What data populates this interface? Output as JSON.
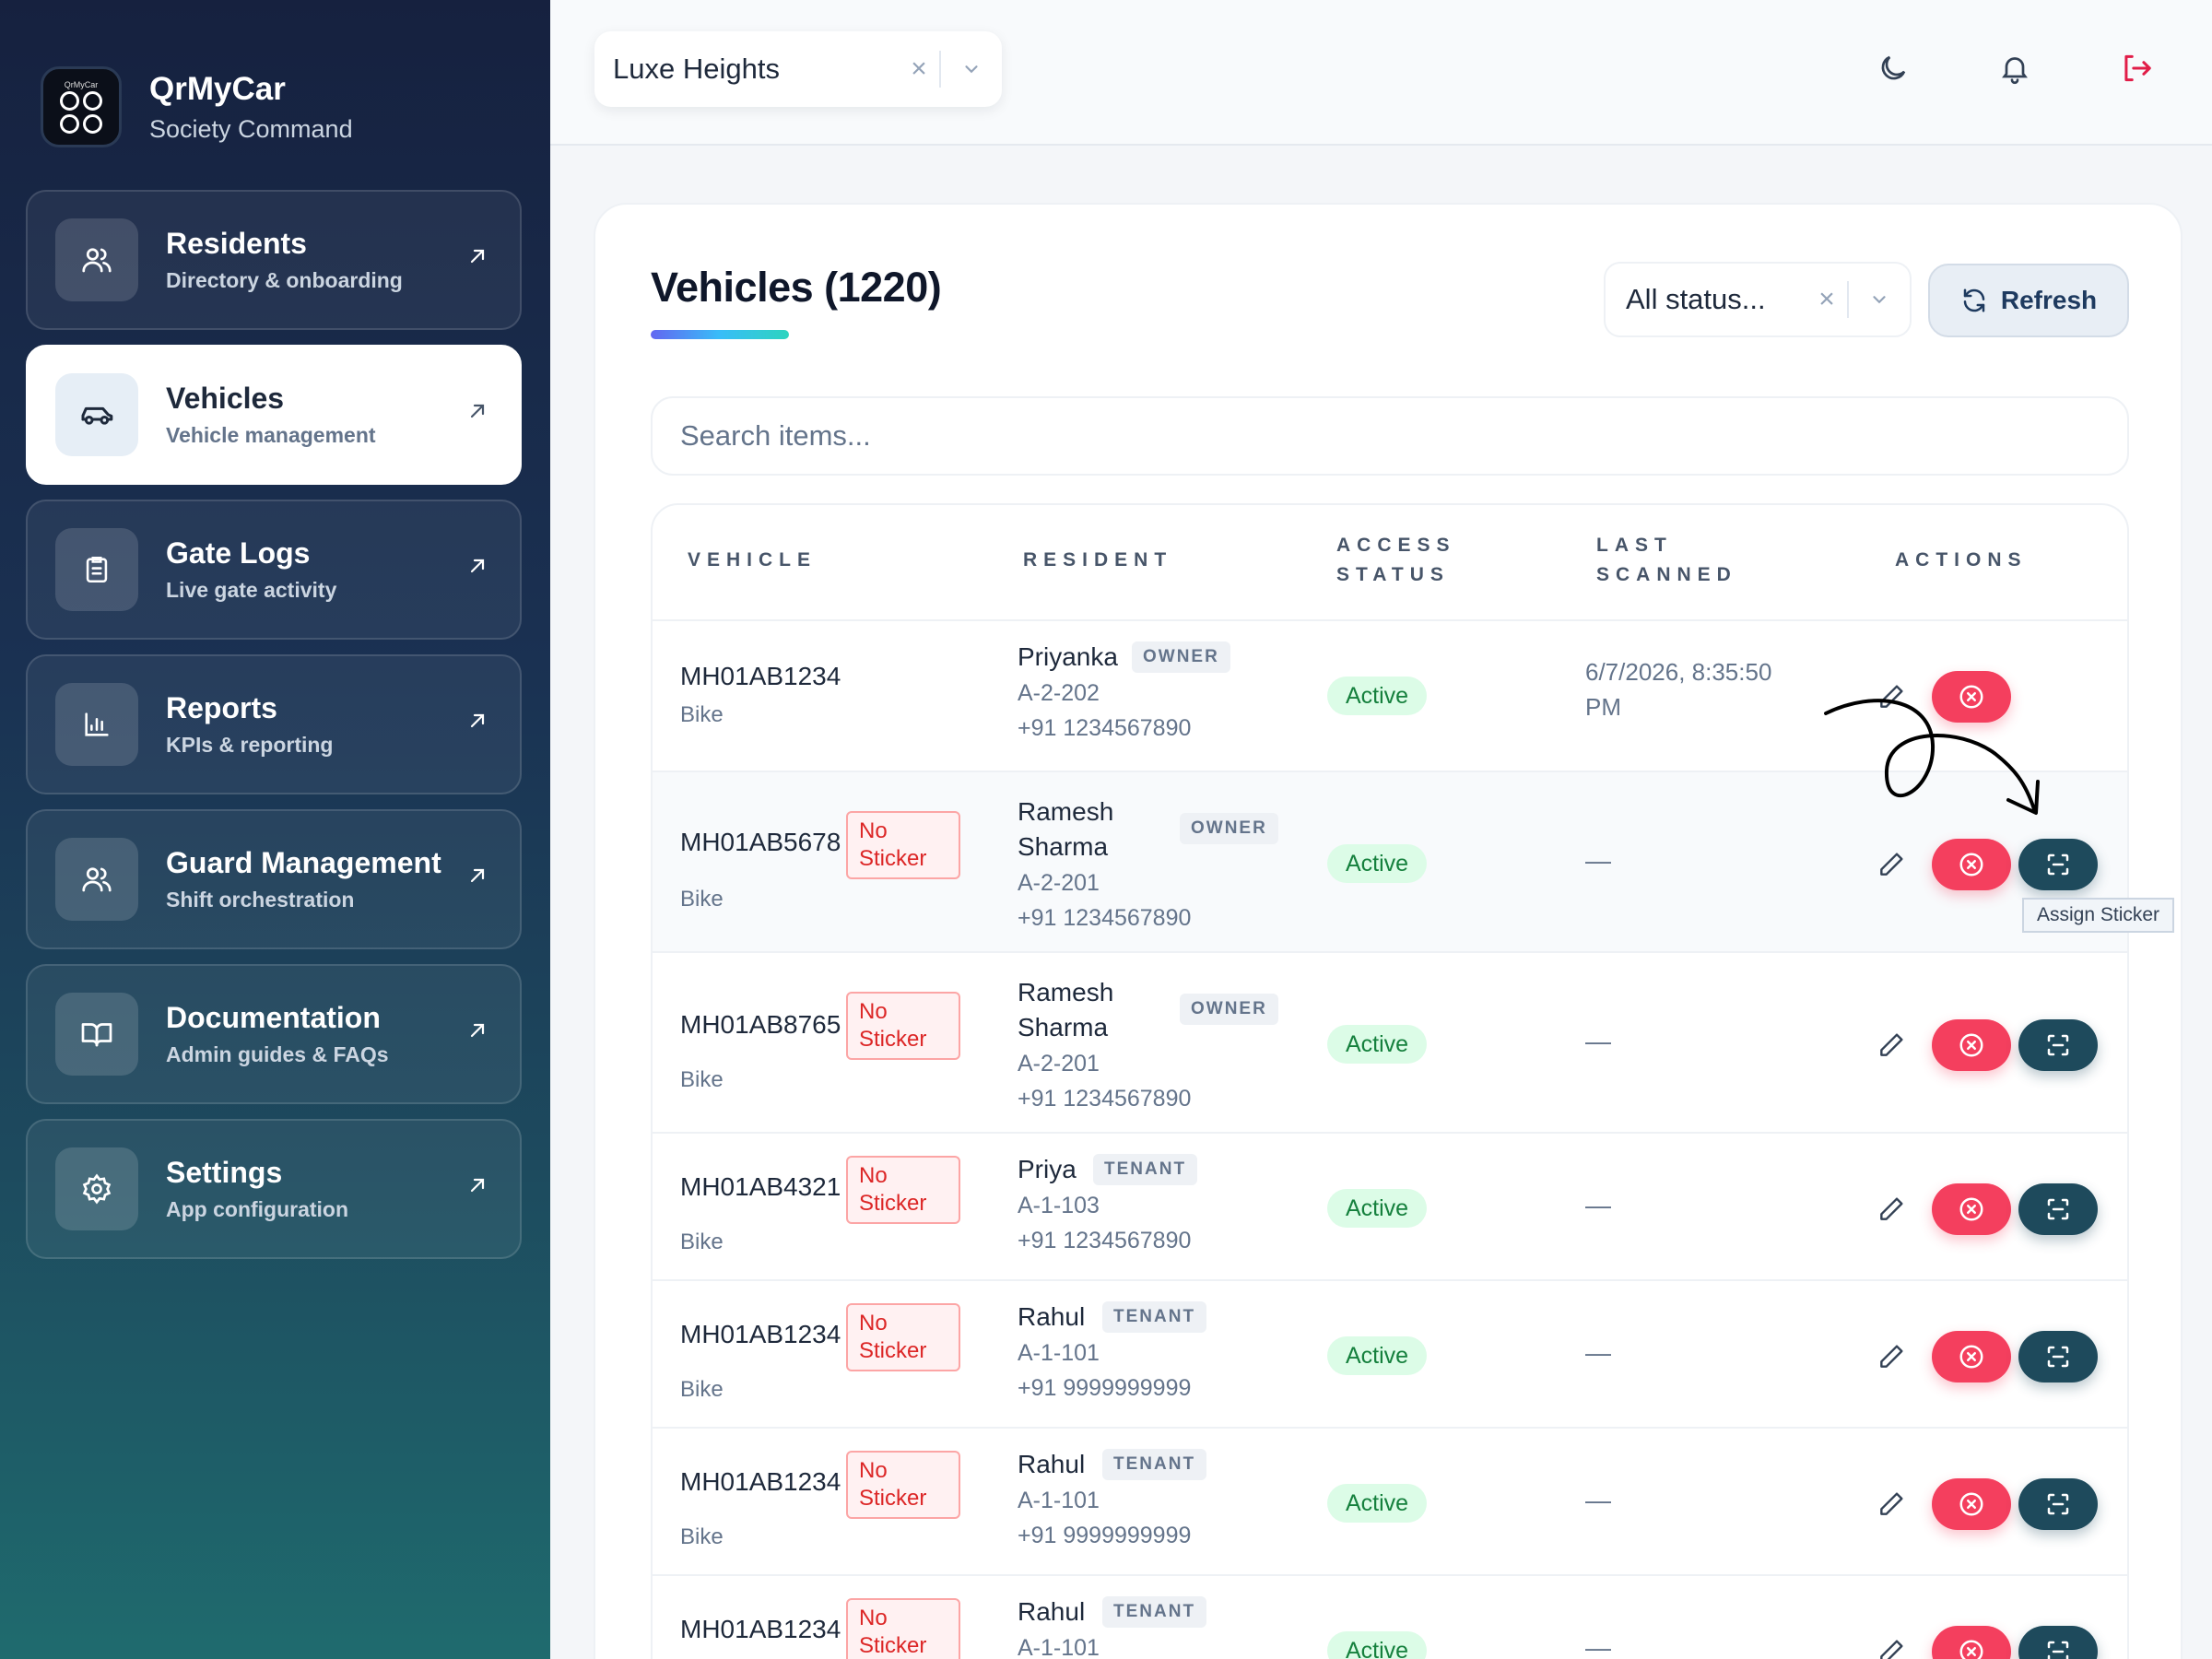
{
  "brand": {
    "logo_text": "QrMyCar",
    "title": "QrMyCar",
    "subtitle": "Society Command"
  },
  "nav": [
    {
      "title": "Residents",
      "subtitle": "Directory & onboarding",
      "icon": "users-icon",
      "active": false
    },
    {
      "title": "Vehicles",
      "subtitle": "Vehicle management",
      "icon": "car-icon",
      "active": true
    },
    {
      "title": "Gate Logs",
      "subtitle": "Live gate activity",
      "icon": "clipboard-icon",
      "active": false
    },
    {
      "title": "Reports",
      "subtitle": "KPIs & reporting",
      "icon": "bar-chart-icon",
      "active": false
    },
    {
      "title": "Guard Management",
      "subtitle": "Shift orchestration",
      "icon": "users-icon",
      "active": false
    },
    {
      "title": "Documentation",
      "subtitle": "Admin guides & FAQs",
      "icon": "book-icon",
      "active": false
    },
    {
      "title": "Settings",
      "subtitle": "App configuration",
      "icon": "gear-icon",
      "active": false
    }
  ],
  "topbar": {
    "society": "Luxe Heights",
    "icons": [
      "moon-icon",
      "bell-icon",
      "logout-icon"
    ]
  },
  "main": {
    "title": "Vehicles (1220)",
    "status_filter": "All status...",
    "refresh_label": "Refresh",
    "search_placeholder": "Search items..."
  },
  "table": {
    "headers": {
      "vehicle": "VEHICLE",
      "resident": "RESIDENT",
      "access_1": "ACCESS",
      "access_2": "STATUS",
      "last_1": "LAST",
      "last_2": "SCANNED",
      "actions": "ACTIONS"
    },
    "rows": [
      {
        "plate": "MH01AB1234",
        "type": "Bike",
        "no_sticker": false,
        "name": "Priyanka",
        "role": "OWNER",
        "unit": "A-2-202",
        "phone": "+91 1234567890",
        "status": "Active",
        "scanned_1": "6/7/2026, 8:35:50",
        "scanned_2": "PM"
      },
      {
        "plate": "MH01AB5678",
        "type": "Bike",
        "no_sticker": true,
        "name_1": "Ramesh",
        "name_2": "Sharma",
        "role": "OWNER",
        "unit": "A-2-201",
        "phone": "+91 1234567890",
        "status": "Active",
        "scanned": "—"
      },
      {
        "plate": "MH01AB8765",
        "type": "Bike",
        "no_sticker": true,
        "name_1": "Ramesh",
        "name_2": "Sharma",
        "role": "OWNER",
        "unit": "A-2-201",
        "phone": "+91 1234567890",
        "status": "Active",
        "scanned": "—"
      },
      {
        "plate": "MH01AB4321",
        "type": "Bike",
        "no_sticker": true,
        "name": "Priya",
        "role": "TENANT",
        "unit": "A-1-103",
        "phone": "+91 1234567890",
        "status": "Active",
        "scanned": "—"
      },
      {
        "plate": "MH01AB1234",
        "type": "Bike",
        "no_sticker": true,
        "name": "Rahul",
        "role": "TENANT",
        "unit": "A-1-101",
        "phone": "+91 9999999999",
        "status": "Active",
        "scanned": "—"
      },
      {
        "plate": "MH01AB1234",
        "type": "Bike",
        "no_sticker": true,
        "name": "Rahul",
        "role": "TENANT",
        "unit": "A-1-101",
        "phone": "+91 9999999999",
        "status": "Active",
        "scanned": "—"
      },
      {
        "plate": "MH01AB1234",
        "type": "",
        "no_sticker": true,
        "name": "Rahul",
        "role": "TENANT",
        "unit": "A-1-101",
        "phone": "",
        "status": "Active",
        "scanned": "—"
      }
    ],
    "no_sticker_1": "No",
    "no_sticker_2": "Sticker"
  },
  "tooltip": "Assign Sticker",
  "colors": {
    "accent": "#1e4a5c",
    "danger": "#f43f5e",
    "success_bg": "#dcfce7",
    "success_text": "#15803d"
  }
}
